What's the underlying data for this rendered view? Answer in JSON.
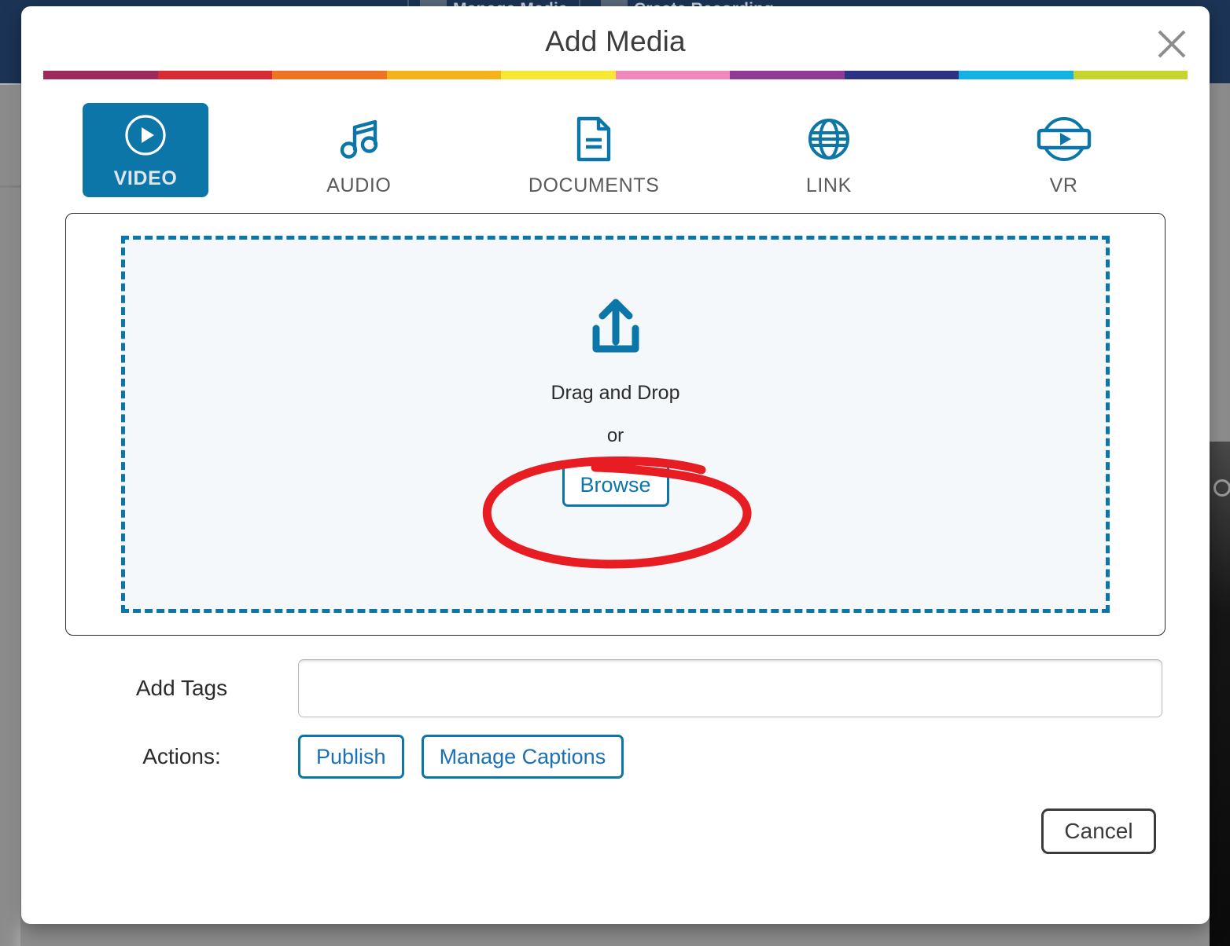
{
  "background": {
    "nav_items": [
      "Manage Media",
      "Create Recording"
    ]
  },
  "modal": {
    "title": "Add Media",
    "close_icon": "close-icon",
    "accent_bar_colors": [
      "#9e2a5c",
      "#d62b33",
      "#ee7422",
      "#f6b21b",
      "#f6e733",
      "#f089b9",
      "#8f3a94",
      "#2b3382",
      "#12b2e5",
      "#c6d430"
    ],
    "tabs": [
      {
        "label": "VIDEO",
        "icon": "video-play-circle-icon",
        "active": true
      },
      {
        "label": "AUDIO",
        "icon": "music-note-icon",
        "active": false
      },
      {
        "label": "DOCUMENTS",
        "icon": "document-page-icon",
        "active": false
      },
      {
        "label": "LINK",
        "icon": "globe-icon",
        "active": false
      },
      {
        "label": "VR",
        "icon": "vr-headset-play-icon",
        "active": false
      }
    ],
    "upload": {
      "icon": "upload-arrow-tray-icon",
      "drag_text": "Drag and Drop",
      "or_text": "or",
      "browse_label": "Browse"
    },
    "form": {
      "tags_label": "Add Tags",
      "tags_value": "",
      "tags_placeholder": "",
      "actions_label": "Actions:",
      "actions": [
        {
          "label": "Publish"
        },
        {
          "label": "Manage Captions"
        }
      ]
    },
    "footer": {
      "cancel_label": "Cancel"
    }
  },
  "annotation": {
    "type": "hand-drawn-ellipse",
    "color": "#e81c23",
    "target": "Browse"
  },
  "colors": {
    "accent_blue": "#0d76a8",
    "link_blue": "#1b6fb5",
    "annotation_red": "#e81c23",
    "navbar_navy": "#1c3557",
    "dropzone_fill": "#f4f8fa"
  }
}
